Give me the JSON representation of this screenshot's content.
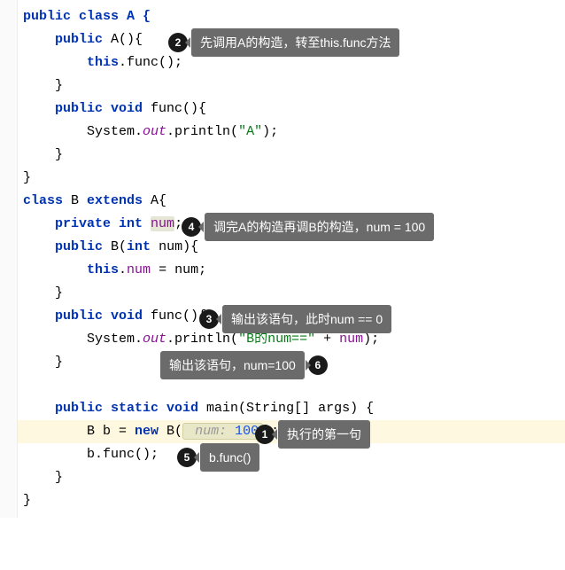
{
  "code": {
    "l01": "public class A {",
    "l02_a": "public",
    "l02_b": " A(){",
    "l03_a": "this",
    "l03_b": ".func();",
    "l04": "}",
    "l05_a": "public void",
    "l05_b": " func(){",
    "l06_a": "System.",
    "l06_b": "out",
    "l06_c": ".println(",
    "l06_d": "\"A\"",
    "l06_e": ");",
    "l07": "}",
    "l08": "}",
    "l09_a": "class",
    "l09_b": " B ",
    "l09_c": "extends",
    "l09_d": " A{",
    "l10_a": "private int ",
    "l10_b": "num",
    "l10_c": ";",
    "l11_a": "public",
    "l11_b": " B(",
    "l11_c": "int",
    "l11_d": " num){",
    "l12_a": "this",
    "l12_b": ".",
    "l12_c": "num",
    "l12_d": " = num;",
    "l13": "}",
    "l14_a": "public void",
    "l14_b": " func(){",
    "l15_a": "System.",
    "l15_b": "out",
    "l15_c": ".println(",
    "l15_d": "\"B的num==\"",
    "l15_e": " + ",
    "l15_f": "num",
    "l15_g": ");",
    "l16": "}",
    "l17_a": "public static void",
    "l17_b": " main(String[] args) {",
    "l18_a": "B b = ",
    "l18_b": "new",
    "l18_c": " B(",
    "l18_d": " num: ",
    "l18_e": "100",
    "l18_f": ");",
    "l19_a": "b.func();",
    "l20": "}",
    "l21": "}"
  },
  "annotations": {
    "a1": {
      "num": "1",
      "text": "执行的第一句"
    },
    "a2": {
      "num": "2",
      "text": "先调用A的构造，转至this.func方法"
    },
    "a3": {
      "num": "3",
      "text": "输出该语句，此时num == 0"
    },
    "a4": {
      "num": "4",
      "text": "调完A的构造再调B的构造，num = 100"
    },
    "a5": {
      "num": "5",
      "text": "b.func()"
    },
    "a6": {
      "num": "6",
      "text": "输出该语句，num=100"
    }
  }
}
